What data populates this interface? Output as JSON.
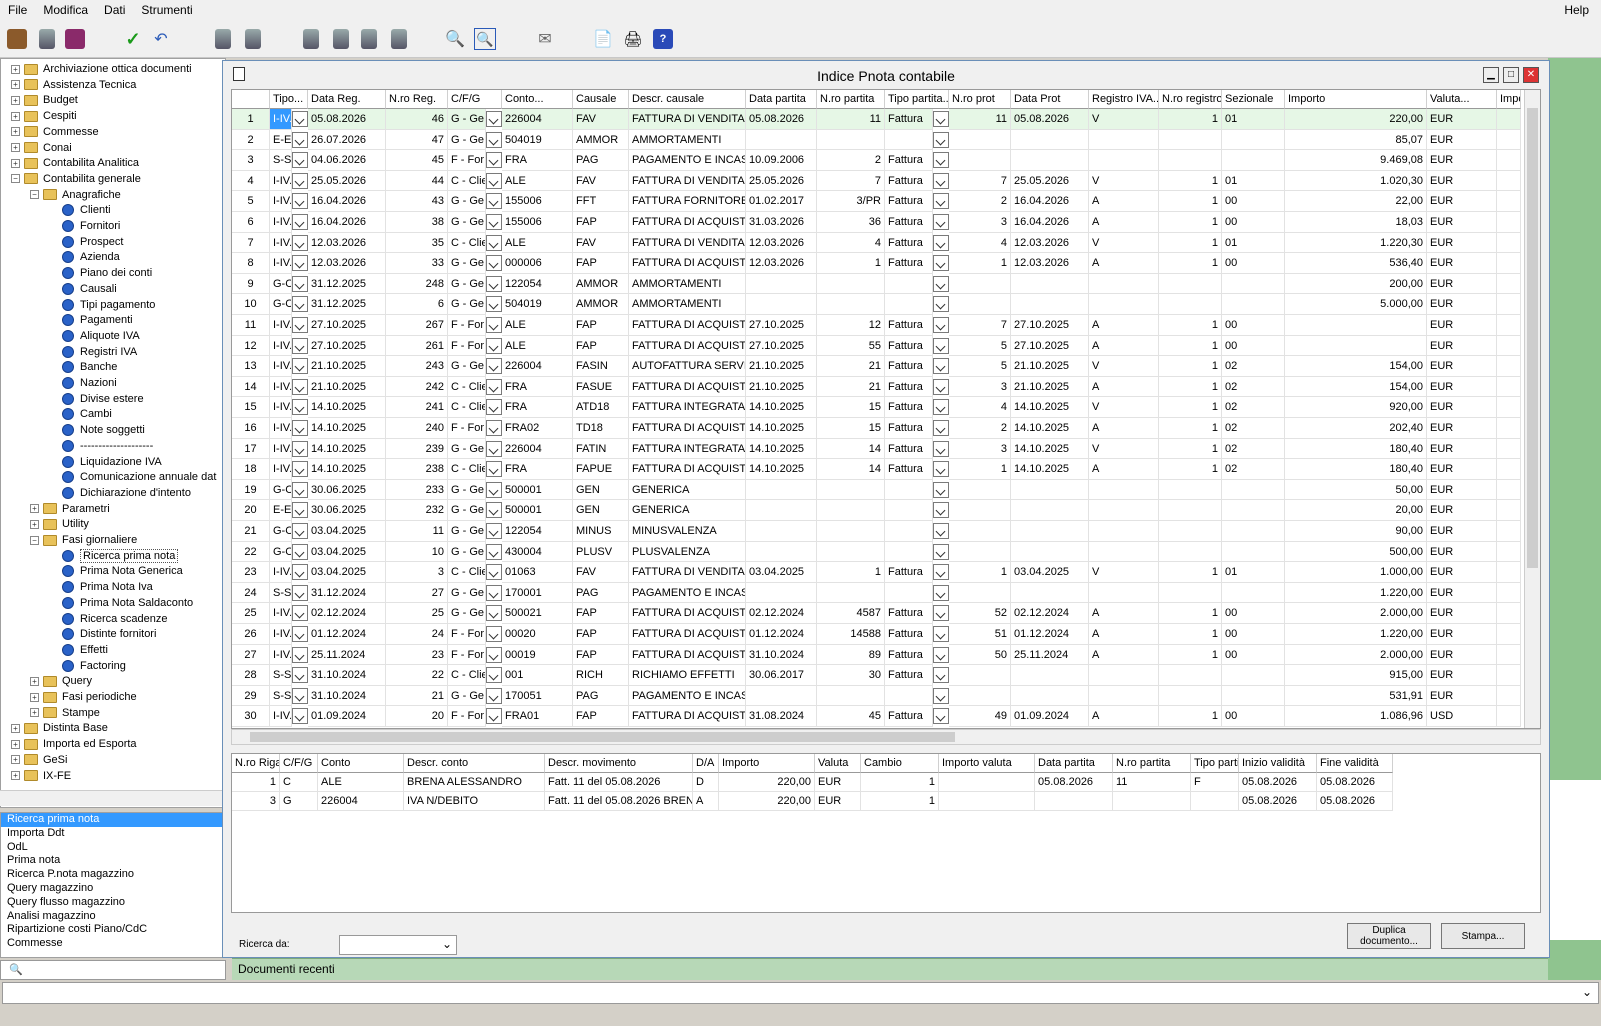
{
  "menu": {
    "file": "File",
    "edit": "Modifica",
    "data": "Dati",
    "tools": "Strumenti",
    "help": "Help"
  },
  "tree": [
    {
      "label": "Archiviazione ottica documenti",
      "lvl": 0,
      "type": "folder"
    },
    {
      "label": "Assistenza Tecnica",
      "lvl": 0,
      "type": "folder"
    },
    {
      "label": "Budget",
      "lvl": 0,
      "type": "folder"
    },
    {
      "label": "Cespiti",
      "lvl": 0,
      "type": "folder"
    },
    {
      "label": "Commesse",
      "lvl": 0,
      "type": "folder"
    },
    {
      "label": "Conai",
      "lvl": 0,
      "type": "folder"
    },
    {
      "label": "Contabilita Analitica",
      "lvl": 0,
      "type": "folder"
    },
    {
      "label": "Contabilita generale",
      "lvl": 0,
      "type": "folder",
      "open": true
    },
    {
      "label": "Anagrafiche",
      "lvl": 1,
      "type": "folder",
      "open": true
    },
    {
      "label": "Clienti",
      "lvl": 2,
      "type": "item"
    },
    {
      "label": "Fornitori",
      "lvl": 2,
      "type": "item"
    },
    {
      "label": "Prospect",
      "lvl": 2,
      "type": "item"
    },
    {
      "label": "Azienda",
      "lvl": 2,
      "type": "item"
    },
    {
      "label": "Piano dei conti",
      "lvl": 2,
      "type": "item"
    },
    {
      "label": "Causali",
      "lvl": 2,
      "type": "item"
    },
    {
      "label": "Tipi pagamento",
      "lvl": 2,
      "type": "item"
    },
    {
      "label": "Pagamenti",
      "lvl": 2,
      "type": "item"
    },
    {
      "label": "Aliquote IVA",
      "lvl": 2,
      "type": "item"
    },
    {
      "label": "Registri IVA",
      "lvl": 2,
      "type": "item"
    },
    {
      "label": "Banche",
      "lvl": 2,
      "type": "item"
    },
    {
      "label": "Nazioni",
      "lvl": 2,
      "type": "item"
    },
    {
      "label": "Divise estere",
      "lvl": 2,
      "type": "item"
    },
    {
      "label": "Cambi",
      "lvl": 2,
      "type": "item"
    },
    {
      "label": "Note soggetti",
      "lvl": 2,
      "type": "item"
    },
    {
      "label": "--------------------",
      "lvl": 2,
      "type": "item"
    },
    {
      "label": "Liquidazione IVA",
      "lvl": 2,
      "type": "item"
    },
    {
      "label": "Comunicazione annuale dat",
      "lvl": 2,
      "type": "item"
    },
    {
      "label": "Dichiarazione d'intento",
      "lvl": 2,
      "type": "item"
    },
    {
      "label": "Parametri",
      "lvl": 1,
      "type": "folder"
    },
    {
      "label": "Utility",
      "lvl": 1,
      "type": "folder"
    },
    {
      "label": "Fasi giornaliere",
      "lvl": 1,
      "type": "folder",
      "open": true
    },
    {
      "label": "Ricerca prima nota",
      "lvl": 2,
      "type": "item"
    },
    {
      "label": "Prima Nota Generica",
      "lvl": 2,
      "type": "item"
    },
    {
      "label": "Prima Nota Iva",
      "lvl": 2,
      "type": "item"
    },
    {
      "label": "Prima Nota Saldaconto",
      "lvl": 2,
      "type": "item"
    },
    {
      "label": "Ricerca scadenze",
      "lvl": 2,
      "type": "item"
    },
    {
      "label": "Distinte fornitori",
      "lvl": 2,
      "type": "item"
    },
    {
      "label": "Effetti",
      "lvl": 2,
      "type": "item"
    },
    {
      "label": "Factoring",
      "lvl": 2,
      "type": "item"
    },
    {
      "label": "Query",
      "lvl": 1,
      "type": "folder"
    },
    {
      "label": "Fasi periodiche",
      "lvl": 1,
      "type": "folder"
    },
    {
      "label": "Stampe",
      "lvl": 1,
      "type": "folder"
    },
    {
      "label": "Distinta Base",
      "lvl": 0,
      "type": "folder"
    },
    {
      "label": "Importa ed Esporta",
      "lvl": 0,
      "type": "folder"
    },
    {
      "label": "GeSi",
      "lvl": 0,
      "type": "folder"
    },
    {
      "label": "IX-FE",
      "lvl": 0,
      "type": "folder"
    }
  ],
  "recent_list": [
    "Ricerca prima nota",
    "Importa Ddt",
    "OdL",
    "Prima nota",
    "Ricerca P.nota magazzino",
    "Query magazzino",
    "Query flusso magazzino",
    "Analisi magazzino",
    "Ripartizione costi Piano/CdC",
    "Commesse"
  ],
  "recent_docs_label": "Documenti recenti",
  "window_title": "Indice Pnota contabile",
  "columns": [
    "Tipo...",
    "Data Reg.",
    "N.ro Reg.",
    "C/F/G",
    "Conto...",
    "Causale",
    "Descr. causale",
    "Data partita",
    "N.ro partita",
    "Tipo partita...",
    "N.ro prot",
    "Data Prot",
    "Registro IVA...",
    "N.ro registro",
    "Sezionale",
    "Importo",
    "Valuta...",
    "Impo"
  ],
  "rows": [
    [
      "I-IV.",
      "05.08.2026",
      "46",
      "G - Ge",
      "226004",
      "FAV",
      "FATTURA DI VENDITA",
      "05.08.2026",
      "11",
      "Fattura",
      "11",
      "05.08.2026",
      "V",
      "1",
      "01",
      "220,00",
      "EUR"
    ],
    [
      "E-E:",
      "26.07.2026",
      "47",
      "G - Ge",
      "504019",
      "AMMOR",
      "AMMORTAMENTI",
      "",
      "",
      "",
      "",
      "",
      "",
      "",
      "",
      "85,07",
      "EUR"
    ],
    [
      "S-S",
      "04.06.2026",
      "45",
      "F - For",
      "FRA",
      "PAG",
      "PAGAMENTO E INCASS",
      "10.09.2006",
      "2",
      "Fattura",
      "",
      "",
      "",
      "",
      "",
      "9.469,08",
      "EUR"
    ],
    [
      "I-IV.",
      "25.05.2026",
      "44",
      "C - Clie",
      "ALE",
      "FAV",
      "FATTURA DI VENDITA",
      "25.05.2026",
      "7",
      "Fattura",
      "7",
      "25.05.2026",
      "V",
      "1",
      "01",
      "1.020,30",
      "EUR"
    ],
    [
      "I-IV.",
      "16.04.2026",
      "43",
      "G - Ge",
      "155006",
      "FFT",
      "FATTURA FORNITORE",
      "01.02.2017",
      "3/PR",
      "Fattura",
      "2",
      "16.04.2026",
      "A",
      "1",
      "00",
      "22,00",
      "EUR"
    ],
    [
      "I-IV.",
      "16.04.2026",
      "38",
      "G - Ge",
      "155006",
      "FAP",
      "FATTURA DI ACQUISTO",
      "31.03.2026",
      "36",
      "Fattura",
      "3",
      "16.04.2026",
      "A",
      "1",
      "00",
      "18,03",
      "EUR"
    ],
    [
      "I-IV.",
      "12.03.2026",
      "35",
      "C - Clie",
      "ALE",
      "FAV",
      "FATTURA DI VENDITA",
      "12.03.2026",
      "4",
      "Fattura",
      "4",
      "12.03.2026",
      "V",
      "1",
      "01",
      "1.220,30",
      "EUR"
    ],
    [
      "I-IV.",
      "12.03.2026",
      "33",
      "G - Ge",
      "000006",
      "FAP",
      "FATTURA DI ACQUISTO",
      "12.03.2026",
      "1",
      "Fattura",
      "1",
      "12.03.2026",
      "A",
      "1",
      "00",
      "536,40",
      "EUR"
    ],
    [
      "G-C",
      "31.12.2025",
      "248",
      "G - Ge",
      "122054",
      "AMMOR",
      "AMMORTAMENTI",
      "",
      "",
      "",
      "",
      "",
      "",
      "",
      "",
      "200,00",
      "EUR"
    ],
    [
      "G-C",
      "31.12.2025",
      "6",
      "G - Ge",
      "504019",
      "AMMOR",
      "AMMORTAMENTI",
      "",
      "",
      "",
      "",
      "",
      "",
      "",
      "",
      "5.000,00",
      "EUR"
    ],
    [
      "I-IV.",
      "27.10.2025",
      "267",
      "F - For",
      "ALE",
      "FAP",
      "FATTURA DI ACQUISTO",
      "27.10.2025",
      "12",
      "Fattura",
      "7",
      "27.10.2025",
      "A",
      "1",
      "00",
      "",
      "EUR"
    ],
    [
      "I-IV.",
      "27.10.2025",
      "261",
      "F - For",
      "ALE",
      "FAP",
      "FATTURA DI ACQUISTO",
      "27.10.2025",
      "55",
      "Fattura",
      "5",
      "27.10.2025",
      "A",
      "1",
      "00",
      "",
      "EUR"
    ],
    [
      "I-IV.",
      "21.10.2025",
      "243",
      "G - Ge",
      "226004",
      "FASIN",
      "AUTOFATTURA SERVIZ",
      "21.10.2025",
      "21",
      "Fattura",
      "5",
      "21.10.2025",
      "V",
      "1",
      "02",
      "154,00",
      "EUR"
    ],
    [
      "I-IV.",
      "21.10.2025",
      "242",
      "C - Clie",
      "FRA",
      "FASUE",
      "FATTURA DI ACQUISTO",
      "21.10.2025",
      "21",
      "Fattura",
      "3",
      "21.10.2025",
      "A",
      "1",
      "02",
      "154,00",
      "EUR"
    ],
    [
      "I-IV.",
      "14.10.2025",
      "241",
      "C - Clie",
      "FRA",
      "ATD18",
      "FATTURA INTEGRATA U",
      "14.10.2025",
      "15",
      "Fattura",
      "4",
      "14.10.2025",
      "V",
      "1",
      "02",
      "920,00",
      "EUR"
    ],
    [
      "I-IV.",
      "14.10.2025",
      "240",
      "F - For",
      "FRA02",
      "TD18",
      "FATTURA DI ACQUISTO",
      "14.10.2025",
      "15",
      "Fattura",
      "2",
      "14.10.2025",
      "A",
      "1",
      "02",
      "202,40",
      "EUR"
    ],
    [
      "I-IV.",
      "14.10.2025",
      "239",
      "G - Ge",
      "226004",
      "FATIN",
      "FATTURA INTEGRATA U",
      "14.10.2025",
      "14",
      "Fattura",
      "3",
      "14.10.2025",
      "V",
      "1",
      "02",
      "180,40",
      "EUR"
    ],
    [
      "I-IV.",
      "14.10.2025",
      "238",
      "C - Clie",
      "FRA",
      "FAPUE",
      "FATTURA DI ACQUISTO",
      "14.10.2025",
      "14",
      "Fattura",
      "1",
      "14.10.2025",
      "A",
      "1",
      "02",
      "180,40",
      "EUR"
    ],
    [
      "G-C",
      "30.06.2025",
      "233",
      "G - Ge",
      "500001",
      "GEN",
      "GENERICA",
      "",
      "",
      "",
      "",
      "",
      "",
      "",
      "",
      "50,00",
      "EUR"
    ],
    [
      "E-E:",
      "30.06.2025",
      "232",
      "G - Ge",
      "500001",
      "GEN",
      "GENERICA",
      "",
      "",
      "",
      "",
      "",
      "",
      "",
      "",
      "20,00",
      "EUR"
    ],
    [
      "G-C",
      "03.04.2025",
      "11",
      "G - Ge",
      "122054",
      "MINUS",
      "MINUSVALENZA",
      "",
      "",
      "",
      "",
      "",
      "",
      "",
      "",
      "90,00",
      "EUR"
    ],
    [
      "G-C",
      "03.04.2025",
      "10",
      "G - Ge",
      "430004",
      "PLUSV",
      "PLUSVALENZA",
      "",
      "",
      "",
      "",
      "",
      "",
      "",
      "",
      "500,00",
      "EUR"
    ],
    [
      "I-IV.",
      "03.04.2025",
      "3",
      "C - Clie",
      "01063",
      "FAV",
      "FATTURA DI VENDITA",
      "03.04.2025",
      "1",
      "Fattura",
      "1",
      "03.04.2025",
      "V",
      "1",
      "01",
      "1.000,00",
      "EUR"
    ],
    [
      "S-S",
      "31.12.2024",
      "27",
      "G - Ge",
      "170001",
      "PAG",
      "PAGAMENTO E INCASS",
      "",
      "",
      "",
      "",
      "",
      "",
      "",
      "",
      "1.220,00",
      "EUR"
    ],
    [
      "I-IV.",
      "02.12.2024",
      "25",
      "G - Ge",
      "500021",
      "FAP",
      "FATTURA DI ACQUISTO",
      "02.12.2024",
      "4587",
      "Fattura",
      "52",
      "02.12.2024",
      "A",
      "1",
      "00",
      "2.000,00",
      "EUR"
    ],
    [
      "I-IV.",
      "01.12.2024",
      "24",
      "F - For",
      "00020",
      "FAP",
      "FATTURA DI ACQUISTO",
      "01.12.2024",
      "14588",
      "Fattura",
      "51",
      "01.12.2024",
      "A",
      "1",
      "00",
      "1.220,00",
      "EUR"
    ],
    [
      "I-IV.",
      "25.11.2024",
      "23",
      "F - For",
      "00019",
      "FAP",
      "FATTURA DI ACQUISTO",
      "31.10.2024",
      "89",
      "Fattura",
      "50",
      "25.11.2024",
      "A",
      "1",
      "00",
      "2.000,00",
      "EUR"
    ],
    [
      "S-S",
      "31.10.2024",
      "22",
      "C - Clie",
      "001",
      "RICH",
      "RICHIAMO EFFETTI",
      "30.06.2017",
      "30",
      "Fattura",
      "",
      "",
      "",
      "",
      "",
      "915,00",
      "EUR"
    ],
    [
      "S-S",
      "31.10.2024",
      "21",
      "G - Ge",
      "170051",
      "PAG",
      "PAGAMENTO E INCASS",
      "",
      "",
      "",
      "",
      "",
      "",
      "",
      "",
      "531,91",
      "EUR"
    ],
    [
      "I-IV.",
      "01.09.2024",
      "20",
      "F - For",
      "FRA01",
      "FAP",
      "FATTURA DI ACQUISTO",
      "31.08.2024",
      "45",
      "Fattura",
      "49",
      "01.09.2024",
      "A",
      "1",
      "00",
      "1.086,96",
      "USD"
    ]
  ],
  "detail_columns": [
    "N.ro Riga",
    "C/F/G",
    "Conto",
    "Descr. conto",
    "Descr. movimento",
    "D/A",
    "Importo",
    "Valuta",
    "Cambio",
    "Importo valuta",
    "Data partita",
    "N.ro partita",
    "Tipo parti",
    "Inizio validità",
    "Fine validità"
  ],
  "detail_rows": [
    [
      "1",
      "C",
      "ALE",
      "BRENA  ALESSANDRO",
      "Fatt. 11 del 05.08.2026",
      "D",
      "220,00",
      "EUR",
      "1",
      "",
      "05.08.2026",
      "11",
      "F",
      "05.08.2026",
      "05.08.2026"
    ],
    [
      "3",
      "G",
      "226004",
      "IVA N/DEBITO",
      "Fatt. 11 del 05.08.2026 BRENA",
      "A",
      "220,00",
      "EUR",
      "1",
      "",
      "",
      "",
      "",
      "05.08.2026",
      "05.08.2026"
    ]
  ],
  "buttons": {
    "duplicate": "Duplica documento...",
    "print": "Stampa..."
  },
  "search_label": "Ricerca da:"
}
